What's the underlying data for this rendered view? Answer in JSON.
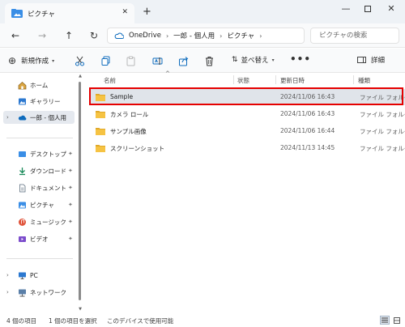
{
  "window": {
    "tab_title": "ピクチャ",
    "tab_close": "✕",
    "new_tab": "+",
    "minimize": "—",
    "close": "✕"
  },
  "nav": {
    "back": "←",
    "forward": "→",
    "up": "↑",
    "refresh": "↻"
  },
  "address": {
    "breadcrumbs": [
      "OneDrive",
      "一郎 - 個人用",
      "ピクチャ"
    ],
    "separator": "›",
    "trailing_chevron": "›"
  },
  "search": {
    "placeholder": "ピクチャの検索"
  },
  "toolbar": {
    "new_label": "新規作成",
    "new_caret": "▾",
    "sort_label": "並べ替え",
    "sort_caret": "▾",
    "more": "•••",
    "details_label": "詳細"
  },
  "sidebar": {
    "items": [
      {
        "label": "ホーム",
        "icon": "home-icon"
      },
      {
        "label": "ギャラリー",
        "icon": "gallery-icon"
      },
      {
        "label": "一郎 - 個人用",
        "icon": "onedrive-icon",
        "selected": true
      },
      {
        "label": "デスクトップ",
        "icon": "desktop-icon",
        "pinned": true
      },
      {
        "label": "ダウンロード",
        "icon": "download-icon",
        "pinned": true
      },
      {
        "label": "ドキュメント",
        "icon": "document-icon",
        "pinned": true
      },
      {
        "label": "ピクチャ",
        "icon": "pictures-icon",
        "pinned": true
      },
      {
        "label": "ミュージック",
        "icon": "music-icon",
        "pinned": true
      },
      {
        "label": "ビデオ",
        "icon": "video-icon",
        "pinned": true
      },
      {
        "label": "PC",
        "icon": "pc-icon"
      },
      {
        "label": "ネットワーク",
        "icon": "network-icon"
      }
    ],
    "chevron": "›",
    "pin": "📌"
  },
  "columns": {
    "name": "名前",
    "status": "状態",
    "date": "更新日時",
    "type": "種類",
    "sort_arrow": "^"
  },
  "files": [
    {
      "name": "Sample",
      "date": "2024/11/06 16:43",
      "type": "ファイル フォルダー",
      "selected": true
    },
    {
      "name": "カメラ ロール",
      "date": "2024/11/06 16:43",
      "type": "ファイル フォルダー"
    },
    {
      "name": "サンプル画像",
      "date": "2024/11/06 16:44",
      "type": "ファイル フォルダー"
    },
    {
      "name": "スクリーンショット",
      "date": "2024/11/13 14:45",
      "type": "ファイル フォルダー"
    }
  ],
  "status": {
    "count": "4 個の項目",
    "selected": "1 個の項目を選択",
    "availability": "このデバイスで使用可能"
  },
  "colors": {
    "folder": "#f6c343",
    "folder_dark": "#e0a92a",
    "highlight": "#e50000",
    "onedrive": "#0f6cbd"
  }
}
